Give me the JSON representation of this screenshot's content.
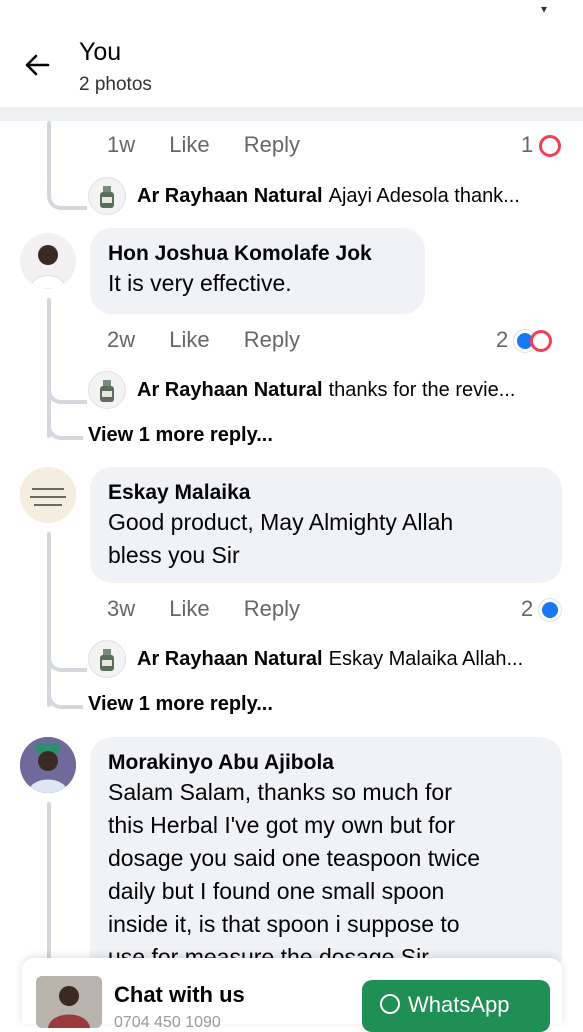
{
  "header": {
    "title": "You",
    "subtitle": "2 photos"
  },
  "comments": [
    {
      "time": "1w",
      "like_label": "Like",
      "reply_label": "Reply",
      "reaction_count": "1",
      "reply": {
        "author": "Ar Rayhaan Natural",
        "preview": "Ajayi Adesola thank..."
      }
    },
    {
      "author": "Hon Joshua Komolafe Jok",
      "text": "It is very effective.",
      "time": "2w",
      "like_label": "Like",
      "reply_label": "Reply",
      "reaction_count": "2",
      "reply": {
        "author": "Ar Rayhaan Natural",
        "preview": "thanks for the revie..."
      },
      "view_more": "View 1 more reply..."
    },
    {
      "author": "Eskay Malaika",
      "text_line1": "Good product, May Almighty Allah",
      "text_line2": "bless you Sir",
      "time": "3w",
      "like_label": "Like",
      "reply_label": "Reply",
      "reaction_count": "2",
      "reply": {
        "author": "Ar Rayhaan Natural",
        "preview": "Eskay Malaika Allah..."
      },
      "view_more": "View 1 more reply..."
    },
    {
      "author": "Morakinyo Abu Ajibola",
      "lines": [
        "Salam Salam, thanks so much for",
        "this Herbal I've got my own but for",
        "dosage you said one teaspoon twice",
        "daily but I found one small spoon",
        "inside it, is that spoon i suppose to",
        "use for measure the dosage Sir"
      ]
    }
  ],
  "chat": {
    "title": "Chat with us",
    "phone": "0704 450 1090",
    "whatsapp_label": "WhatsApp"
  },
  "colors": {
    "whatsapp": "#1f8f55",
    "like_blue": "#1877f2",
    "love_red": "#f33e58",
    "bubble": "#f0f2f5"
  }
}
